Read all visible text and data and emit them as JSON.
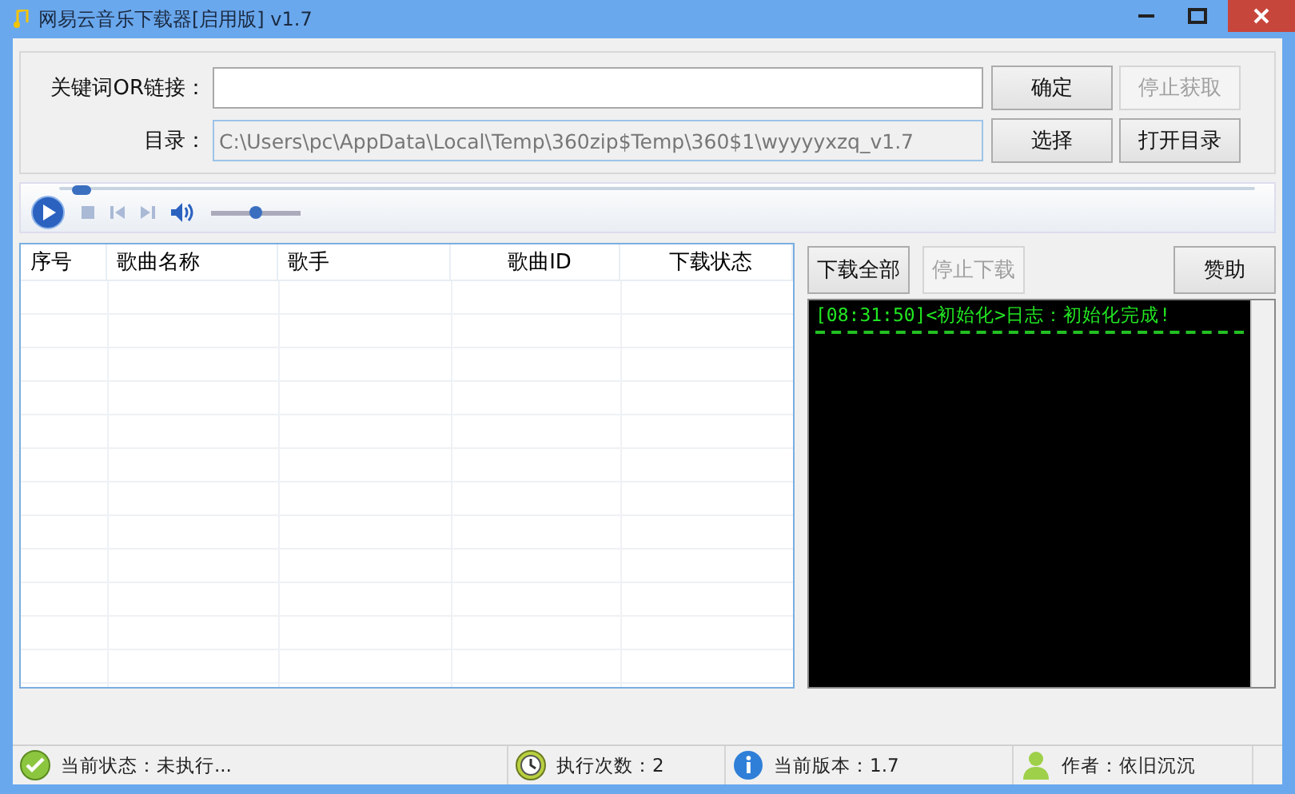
{
  "window": {
    "title": "网易云音乐下载器[启用版] v1.7"
  },
  "form": {
    "rows": [
      {
        "label": "关键词OR链接：",
        "value": "",
        "buttons": [
          {
            "label": "确定",
            "disabled": false
          },
          {
            "label": "停止获取",
            "disabled": true
          }
        ]
      },
      {
        "label": "目录：",
        "value": "C:\\Users\\pc\\AppData\\Local\\Temp\\360zip$Temp\\360$1\\wyyyyxzq_v1.7",
        "buttons": [
          {
            "label": "选择",
            "disabled": false
          },
          {
            "label": "打开目录",
            "disabled": false
          }
        ]
      }
    ]
  },
  "player": {
    "seek": {
      "level": 0.01
    },
    "volume": {
      "level": 0.5
    }
  },
  "table": {
    "columns": [
      "序号",
      "歌曲名称",
      "歌手",
      "歌曲ID",
      "下载状态"
    ]
  },
  "actions": [
    {
      "label": "下载全部",
      "disabled": false
    },
    {
      "label": "停止下载",
      "disabled": true
    },
    {
      "label": "赞助",
      "disabled": false
    }
  ],
  "log": {
    "lines": [
      "[08:31:50]<初始化>日志：初始化完成!"
    ]
  },
  "status_bar": [
    {
      "kind": "check",
      "text": "当前状态：未执行..."
    },
    {
      "kind": "clock",
      "text": "执行次数：2"
    },
    {
      "kind": "info",
      "text": "当前版本：1.7"
    },
    {
      "kind": "user",
      "text": "作者：依旧沉沉"
    }
  ]
}
